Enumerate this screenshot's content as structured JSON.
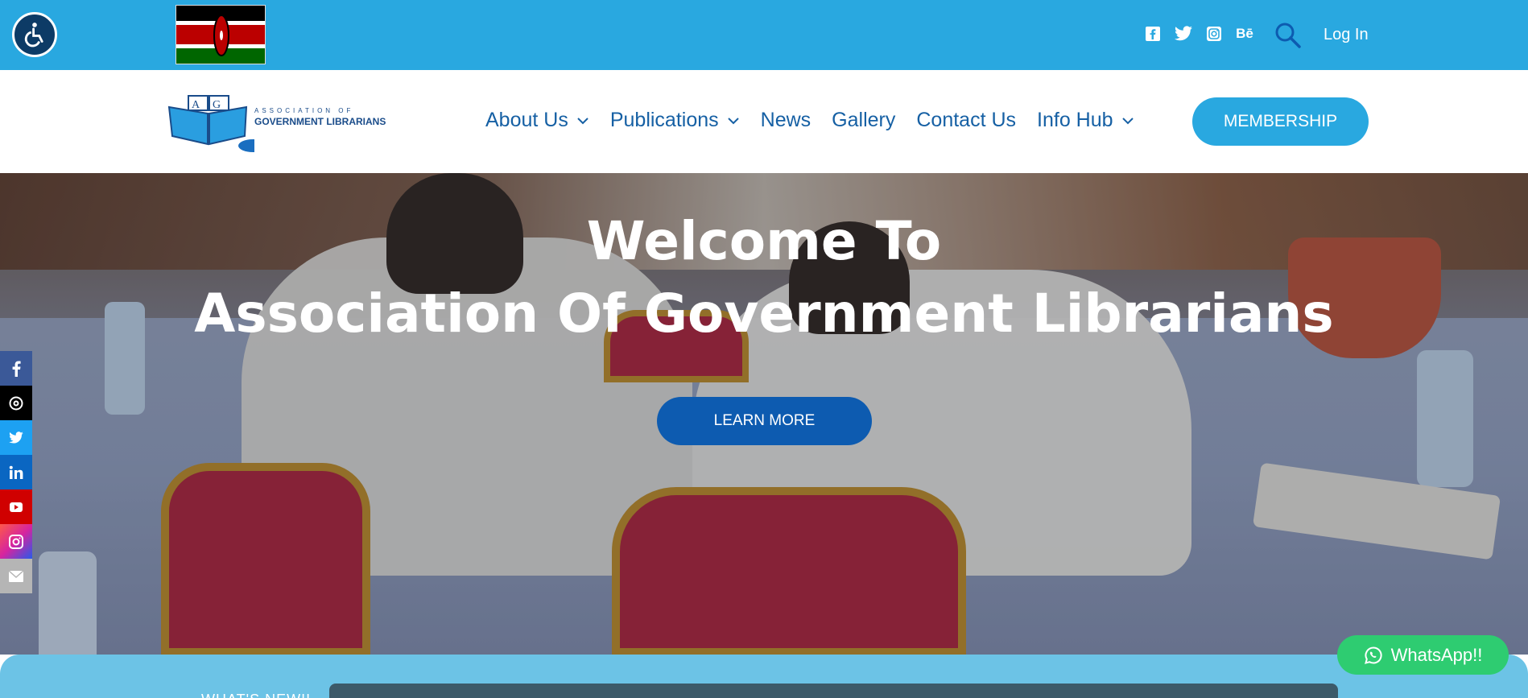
{
  "topbar": {
    "accessibility_icon": "wheelchair-icon",
    "flag_alt": "kenya-flag",
    "social_icons": [
      "facebook-icon",
      "twitter-icon",
      "instagram-icon",
      "behance-icon"
    ],
    "behance_label": "Bē",
    "search_icon": "search-icon",
    "login_label": "Log In",
    "colors": {
      "bar": "#29a8e0"
    }
  },
  "header": {
    "logo_line1": "ASSOCIATION OF",
    "logo_line2": "GOVERNMENT LIBRARIANS",
    "logo_letters": "AGL",
    "nav": [
      {
        "label": "About Us",
        "has_dropdown": true
      },
      {
        "label": "Publications",
        "has_dropdown": true
      },
      {
        "label": "News",
        "has_dropdown": false
      },
      {
        "label": "Gallery",
        "has_dropdown": false
      },
      {
        "label": "Contact Us",
        "has_dropdown": false
      },
      {
        "label": "Info Hub",
        "has_dropdown": true
      }
    ],
    "membership_label": "MEMBERSHIP"
  },
  "hero": {
    "title_line1": "Welcome To",
    "title_line2": "Association Of Government Librarians",
    "cta_label": "LEARN MORE"
  },
  "side_social": [
    "facebook-icon",
    "threads-icon",
    "twitter-icon",
    "linkedin-icon",
    "youtube-icon",
    "instagram-icon",
    "email-icon"
  ],
  "bottom": {
    "whats_new": "WHAT'S NEW!!"
  },
  "whatsapp_label": "WhatsApp!!"
}
